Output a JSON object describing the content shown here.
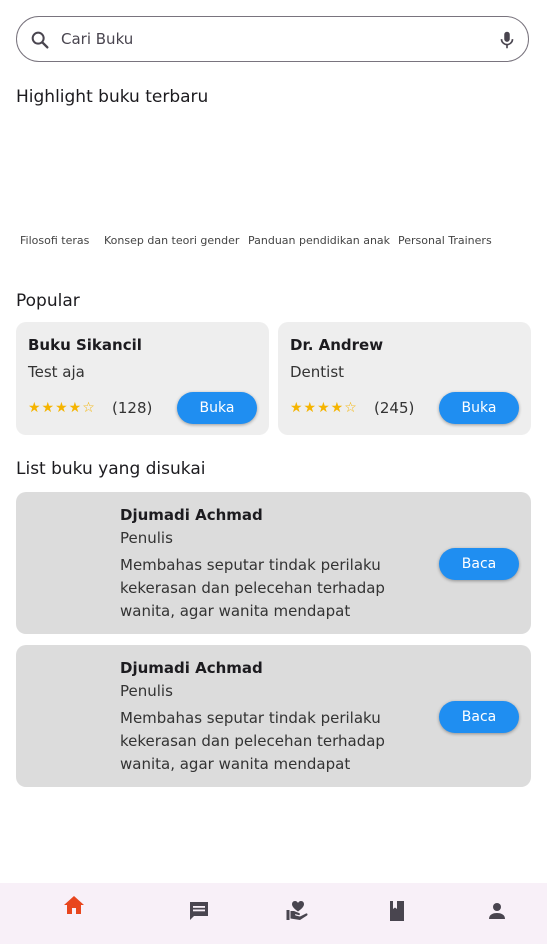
{
  "search": {
    "placeholder": "Cari Buku"
  },
  "highlight": {
    "title": "Highlight buku terbaru",
    "items": [
      {
        "caption": "Filosofi teras"
      },
      {
        "caption": "Konsep dan teori gender"
      },
      {
        "caption": "Panduan pendidikan anak"
      },
      {
        "caption": "Personal Trainers"
      }
    ]
  },
  "popular": {
    "title": "Popular",
    "cards": [
      {
        "title": "Buku Sikancil",
        "subtitle": "Test aja",
        "rating_text": "(128)",
        "rating": 4,
        "button": "Buka"
      },
      {
        "title": "Dr. Andrew",
        "subtitle": "Dentist",
        "rating_text": "(245)",
        "rating": 4,
        "button": "Buka"
      }
    ]
  },
  "favorites": {
    "title": "List buku yang disukai",
    "items": [
      {
        "name": "Djumadi Achmad",
        "role": "Penulis",
        "desc": "Membahas seputar tindak perilaku kekerasan dan pelecehan terhadap wanita, agar wanita mendapat kesetaraa…",
        "button": "Baca"
      },
      {
        "name": "Djumadi Achmad",
        "role": "Penulis",
        "desc": "Membahas seputar tindak perilaku kekerasan dan pelecehan terhadap wanita, agar wanita mendapat kesetaraa…",
        "button": "Baca"
      }
    ]
  },
  "nav": {
    "items": [
      {
        "icon": "home-icon",
        "active": true
      },
      {
        "icon": "chat-icon"
      },
      {
        "icon": "volunteer-icon"
      },
      {
        "icon": "book-icon"
      },
      {
        "icon": "person-icon"
      }
    ],
    "active_color": "#e8461e",
    "inactive_color": "#49454f"
  },
  "colors": {
    "accent": "#1f8ef1",
    "star": "#f5b400",
    "card": "#eeeeee",
    "fav_card": "#dcdcdc"
  }
}
